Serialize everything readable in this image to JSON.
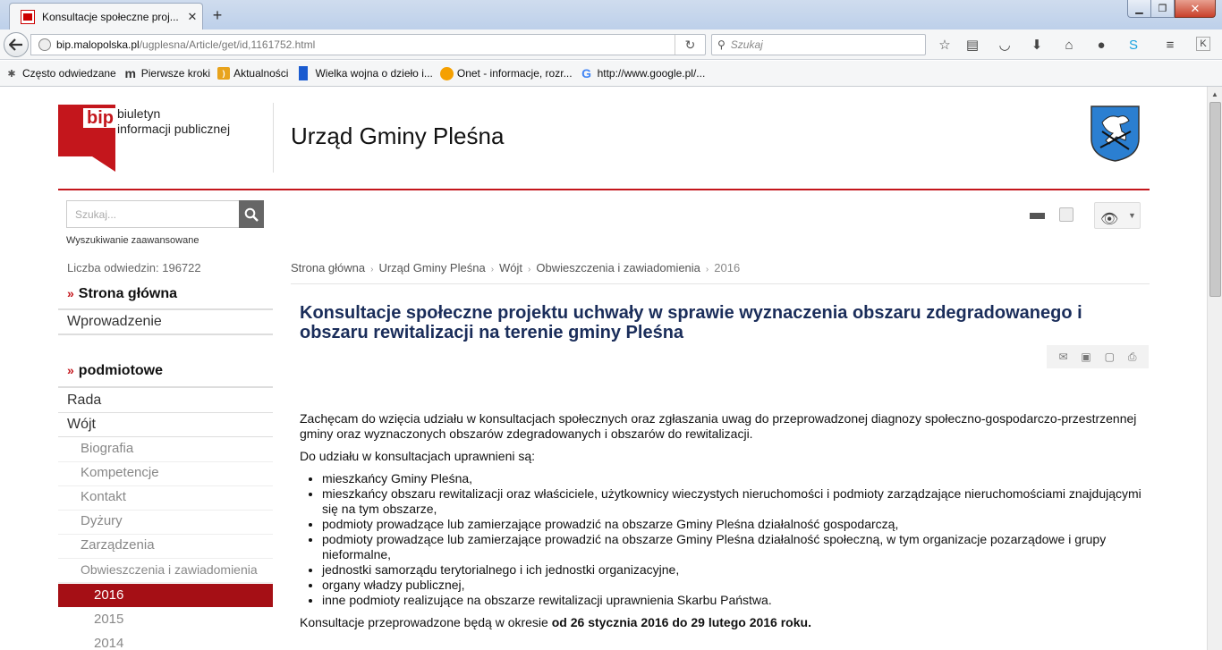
{
  "browser": {
    "tab_title": "Konsultacje społeczne proj...",
    "tab_close": "✕",
    "new_tab": "+",
    "url_host": "bip.malopolska.pl",
    "url_path": "/ugplesna/Article/get/id,1161752.html",
    "search_placeholder": "Szukaj",
    "win_min": "▁",
    "win_max": "❐",
    "win_close": "✕",
    "bookmarks": [
      {
        "label": "Często odwiedzane",
        "icon": "bookmark-gear-icon"
      },
      {
        "label": "Pierwsze kroki",
        "icon": "m-logo-icon"
      },
      {
        "label": "Aktualności",
        "icon": "rss-icon"
      },
      {
        "label": "Wielka wojna o dzieło i...",
        "icon": "blue-bookmark-icon"
      },
      {
        "label": "Onet - informacje, rozr...",
        "icon": "onet-icon"
      },
      {
        "label": "http://www.google.pl/...",
        "icon": "google-icon"
      }
    ]
  },
  "header": {
    "bip_word": "bip",
    "bip_line1": "biuletyn",
    "bip_line2": "informacji publicznej",
    "site_title": "Urząd Gminy Pleśna"
  },
  "sidebar": {
    "search_placeholder": "Szukaj...",
    "advanced_search": "Wyszukiwanie zaawansowane",
    "visits": "Liczba odwiedzin: 196722",
    "home": "Strona główna",
    "intro": "Wprowadzenie",
    "section": "podmiotowe",
    "rada": "Rada",
    "wojt": "Wójt",
    "wojt_sub": [
      "Biografia",
      "Kompetencje",
      "Kontakt",
      "Dyżury",
      "Zarządzenia",
      "Obwieszczenia i zawiadomienia"
    ],
    "years": [
      "2016",
      "2015",
      "2014"
    ]
  },
  "breadcrumb": {
    "items": [
      "Strona główna",
      "Urząd Gminy Pleśna",
      "Wójt",
      "Obwieszczenia i zawiadomienia"
    ],
    "current": "2016"
  },
  "article": {
    "title": "Konsultacje społeczne projektu uchwały w sprawie wyznaczenia obszaru zdegradowanego i obszaru rewitalizacji na terenie gminy Pleśna",
    "intro": "Zachęcam do wzięcia udziału w konsultacjach społecznych oraz zgłaszania uwag do przeprowadzonej diagnozy społeczno-gospodarczo-przestrzennej gminy oraz wyznaczonych obszarów zdegradowanych i obszarów do rewitalizacji.",
    "eligible_heading": "Do udziału w konsultacjach uprawnieni są:",
    "eligible": [
      "mieszkańcy Gminy Pleśna,",
      "mieszkańcy obszaru rewitalizacji oraz właściciele, użytkownicy wieczystych nieruchomości i podmioty zarządzające nieruchomościami znajdującymi się na tym obszarze,",
      "podmioty prowadzące lub zamierzające prowadzić na obszarze Gminy Pleśna działalność gospodarczą,",
      "podmioty prowadzące lub zamierzające prowadzić na obszarze Gminy Pleśna działalność społeczną, w tym organizacje pozarządowe i grupy nieformalne,",
      "jednostki samorządu terytorialnego i ich jednostki organizacyjne,",
      "organy władzy publicznej,",
      "inne podmioty realizujące na obszarze rewitalizacji uprawnienia Skarbu Państwa."
    ],
    "period_text": "Konsultacje przeprowadzone będą w okresie ",
    "period_bold": "od 26 stycznia 2016 do 29 lutego 2016 roku."
  }
}
